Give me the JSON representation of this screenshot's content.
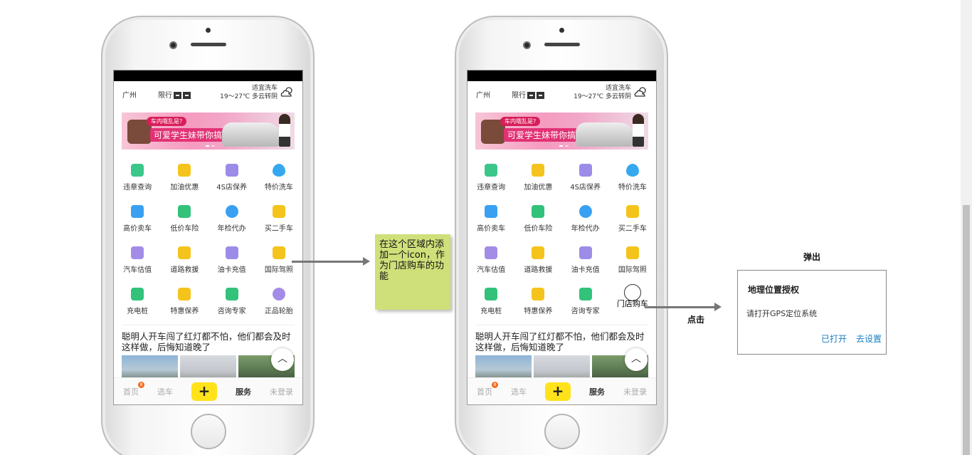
{
  "phone": {
    "city": "广州",
    "restriction": "限行",
    "wash_status": "适宜洗车",
    "weather": "19～27℃ 多云转阴",
    "banner": {
      "tag": "车内哦乱是?",
      "slogan": "可爱学生妹带你搞定"
    },
    "services": [
      {
        "label": "违章查询",
        "icon": "violation-search-icon",
        "color": "#3cc78a"
      },
      {
        "label": "加油优惠",
        "icon": "fuel-icon",
        "color": "#f5c41c"
      },
      {
        "label": "4S店保养",
        "icon": "4s-shop-icon",
        "color": "#9c8ce8"
      },
      {
        "label": "特价洗车",
        "icon": "water-drop-icon",
        "color": "#35a8f0"
      },
      {
        "label": "高价卖车",
        "icon": "sell-car-icon",
        "color": "#3aa1f2"
      },
      {
        "label": "低价车险",
        "icon": "shield-check-icon",
        "color": "#32c27a"
      },
      {
        "label": "年检代办",
        "icon": "inspector-icon",
        "color": "#3aa1f2"
      },
      {
        "label": "买二手车",
        "icon": "used-car-icon",
        "color": "#f5c41c"
      },
      {
        "label": "汽车估值",
        "icon": "calculator-icon",
        "color": "#a38ce8"
      },
      {
        "label": "道路救援",
        "icon": "tow-truck-icon",
        "color": "#f5c41c"
      },
      {
        "label": "油卡充值",
        "icon": "fuel-card-icon",
        "color": "#9c8ce8"
      },
      {
        "label": "国际驾照",
        "icon": "license-card-icon",
        "color": "#f5c41c"
      },
      {
        "label": "充电桩",
        "icon": "charging-pile-icon",
        "color": "#32c27a"
      },
      {
        "label": "特惠保养",
        "icon": "shop-icon",
        "color": "#f5c41c"
      },
      {
        "label": "咨询专家",
        "icon": "graduation-cap-icon",
        "color": "#32c27a"
      },
      {
        "label": "正品轮胎",
        "icon": "tire-icon",
        "color": "#a38ce8"
      }
    ],
    "new_service_label": "门店购车",
    "news_title": "聪明人开车闯了红灯都不怕，他们都会及时这样做，后悔知道晚了",
    "tabs": {
      "home": "首页",
      "home_badge": "8",
      "select_car": "选车",
      "plus": "+",
      "service": "服务",
      "login": "未登录"
    }
  },
  "annotation": {
    "note": "在这个区域内添加一个icon，作为门店购车的功能",
    "click": "点击",
    "popup": "弹出"
  },
  "dialog": {
    "title": "地理位置授权",
    "message": "请打开GPS定位系统",
    "opened_button": "已打开",
    "settings_button": "去设置"
  }
}
